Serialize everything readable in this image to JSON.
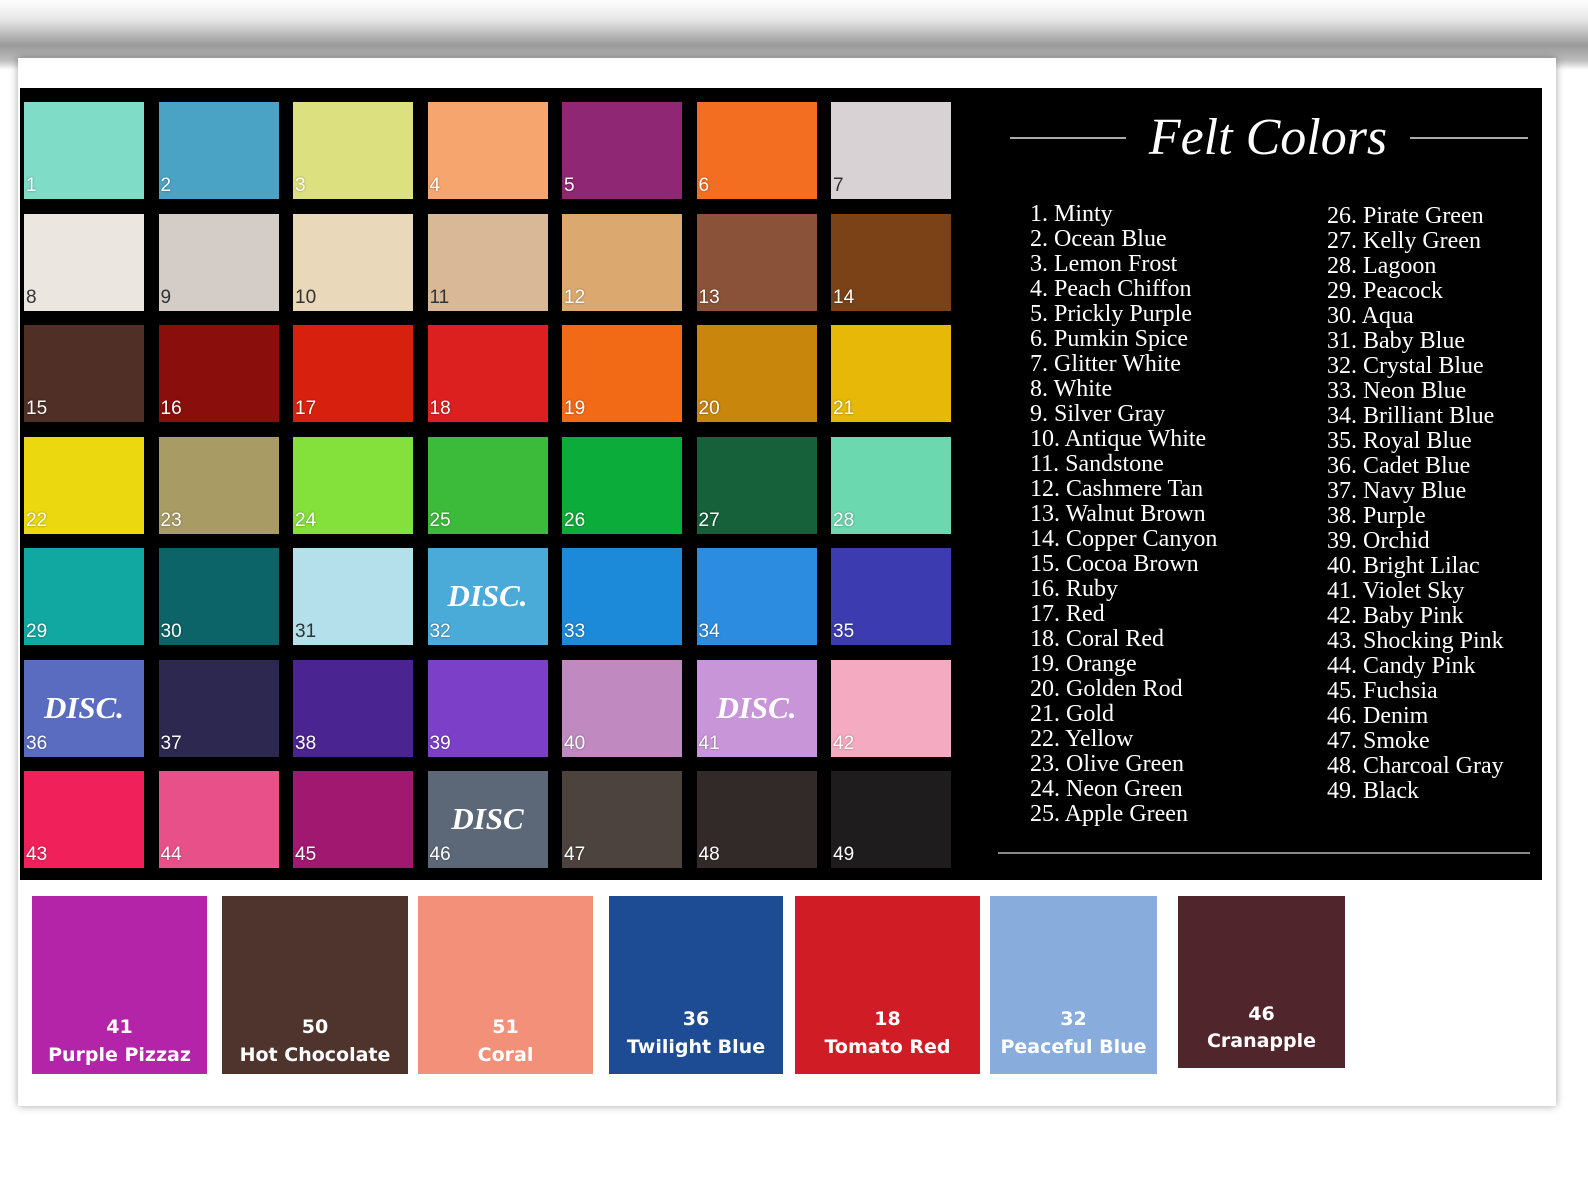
{
  "title": "Felt Colors",
  "swatches": [
    {
      "n": "1",
      "c": "#7fdcc6"
    },
    {
      "n": "2",
      "c": "#4aa3c5"
    },
    {
      "n": "3",
      "c": "#dde07e"
    },
    {
      "n": "4",
      "c": "#f7a56e"
    },
    {
      "n": "5",
      "c": "#902775"
    },
    {
      "n": "6",
      "c": "#f46e22"
    },
    {
      "n": "7",
      "c": "#d8d2d4"
    },
    {
      "n": "8",
      "c": "#ece6e0"
    },
    {
      "n": "9",
      "c": "#d4ccc6"
    },
    {
      "n": "10",
      "c": "#ead8ba"
    },
    {
      "n": "11",
      "c": "#d8b896"
    },
    {
      "n": "12",
      "c": "#dba870"
    },
    {
      "n": "13",
      "c": "#8a5238"
    },
    {
      "n": "14",
      "c": "#7a4216"
    },
    {
      "n": "15",
      "c": "#4f2f26"
    },
    {
      "n": "16",
      "c": "#8a0f0c"
    },
    {
      "n": "17",
      "c": "#d8200e"
    },
    {
      "n": "18",
      "c": "#dc2020"
    },
    {
      "n": "19",
      "c": "#f26a16"
    },
    {
      "n": "20",
      "c": "#c8860c"
    },
    {
      "n": "21",
      "c": "#e8b808"
    },
    {
      "n": "22",
      "c": "#ecd80e"
    },
    {
      "n": "23",
      "c": "#a89c64"
    },
    {
      "n": "24",
      "c": "#84e03a"
    },
    {
      "n": "25",
      "c": "#3cba3a"
    },
    {
      "n": "26",
      "c": "#0cac3a"
    },
    {
      "n": "27",
      "c": "#16603a"
    },
    {
      "n": "28",
      "c": "#6cd8b0"
    },
    {
      "n": "29",
      "c": "#10a8a0"
    },
    {
      "n": "30",
      "c": "#0c6468"
    },
    {
      "n": "31",
      "c": "#b4e0ec"
    },
    {
      "n": "32",
      "c": "#4aaad8",
      "disc": "DISC."
    },
    {
      "n": "33",
      "c": "#1c8ad8"
    },
    {
      "n": "34",
      "c": "#2c8ce0"
    },
    {
      "n": "35",
      "c": "#3c3cb0"
    },
    {
      "n": "36",
      "c": "#5a6cc0",
      "disc": "DISC."
    },
    {
      "n": "37",
      "c": "#2c2850"
    },
    {
      "n": "38",
      "c": "#4a2490"
    },
    {
      "n": "39",
      "c": "#7c40c8"
    },
    {
      "n": "40",
      "c": "#c08ac0"
    },
    {
      "n": "41",
      "c": "#c896d8",
      "disc": "DISC."
    },
    {
      "n": "42",
      "c": "#f4aac0"
    },
    {
      "n": "43",
      "c": "#f0205a"
    },
    {
      "n": "44",
      "c": "#e8508a"
    },
    {
      "n": "45",
      "c": "#a01870"
    },
    {
      "n": "46",
      "c": "#5c6878",
      "disc": "DISC"
    },
    {
      "n": "47",
      "c": "#4c423e"
    },
    {
      "n": "48",
      "c": "#322a28"
    },
    {
      "n": "49",
      "c": "#1e1c1c"
    }
  ],
  "legend_left": [
    "1. Minty",
    "2. Ocean Blue",
    "3. Lemon Frost",
    "4. Peach Chiffon",
    "5. Prickly Purple",
    "6. Pumkin Spice",
    "7. Glitter White",
    "8. White",
    "9. Silver Gray",
    "10. Antique White",
    "11. Sandstone",
    "12. Cashmere Tan",
    "13. Walnut Brown",
    "14. Copper Canyon",
    "15. Cocoa Brown",
    "16. Ruby",
    "17. Red",
    "18. Coral Red",
    "19. Orange",
    "20. Golden Rod",
    "21. Gold",
    "22. Yellow",
    "23. Olive Green",
    "24. Neon Green",
    "25. Apple Green"
  ],
  "legend_right": [
    "26. Pirate Green",
    "27. Kelly Green",
    "28. Lagoon",
    "29. Peacock",
    "30. Aqua",
    "31. Baby Blue",
    "32. Crystal Blue",
    "33. Neon Blue",
    "34. Brilliant Blue",
    "35. Royal Blue",
    "36. Cadet Blue",
    "37. Navy Blue",
    "38. Purple",
    "39. Orchid",
    "40. Bright Lilac",
    "41. Violet Sky",
    "42. Baby Pink",
    "43. Shocking Pink",
    "44. Candy Pink",
    "45. Fuchsia",
    "46. Denim",
    "47. Smoke",
    "48. Charcoal Gray",
    "49. Black"
  ],
  "bottom": [
    {
      "n": "41",
      "label": "Purple Pizzaz",
      "c": "#b424a8"
    },
    {
      "n": "50",
      "label": "Hot Chocolate",
      "c": "#4e342c"
    },
    {
      "n": "51",
      "label": "Coral",
      "c": "#f2907a"
    },
    {
      "n": "36",
      "label": "Twilight Blue",
      "c": "#1e4c94"
    },
    {
      "n": "18",
      "label": "Tomato Red",
      "c": "#d01c24"
    },
    {
      "n": "32",
      "label": "Peaceful Blue",
      "c": "#88acdc"
    },
    {
      "n": "46",
      "label": "Cranapple",
      "c": "#50262c"
    }
  ]
}
